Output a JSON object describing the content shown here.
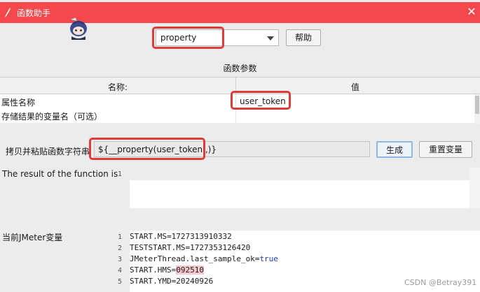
{
  "window": {
    "title": "函数助手"
  },
  "function_selector": {
    "selected": "property",
    "help_label": "帮助"
  },
  "params": {
    "title": "函数参数",
    "col_name": "名称:",
    "col_value": "值",
    "rows": [
      {
        "name": "属性名称",
        "value": "user_token"
      },
      {
        "name": "存储结果的变量名（可选）",
        "value": ""
      }
    ]
  },
  "copy": {
    "label": "拷贝并粘贴函数字符串",
    "value": "${__property(user_token,,)}",
    "generate_label": "生成",
    "reset_label": "重置变量"
  },
  "result": {
    "label": "The result of the function is",
    "line_number": "1"
  },
  "vars": {
    "label": "当前JMeter变量",
    "lines": [
      {
        "num": "1",
        "text": "START.MS=1727313910332"
      },
      {
        "num": "2",
        "text": "TESTSTART.MS=1727353126420"
      },
      {
        "num": "3",
        "prefix": "JMeterThread.last_sample_ok=",
        "keyword": "true"
      },
      {
        "num": "4",
        "prefix": "START.HMS=",
        "highlight": "092510"
      },
      {
        "num": "5",
        "text": "START.YMD=20240926"
      }
    ]
  },
  "watermark": "CSDN @Betray391",
  "colors": {
    "titlebar": "#f5484c",
    "annotation": "#e03b3b",
    "keyword": "#1a3bb5"
  }
}
